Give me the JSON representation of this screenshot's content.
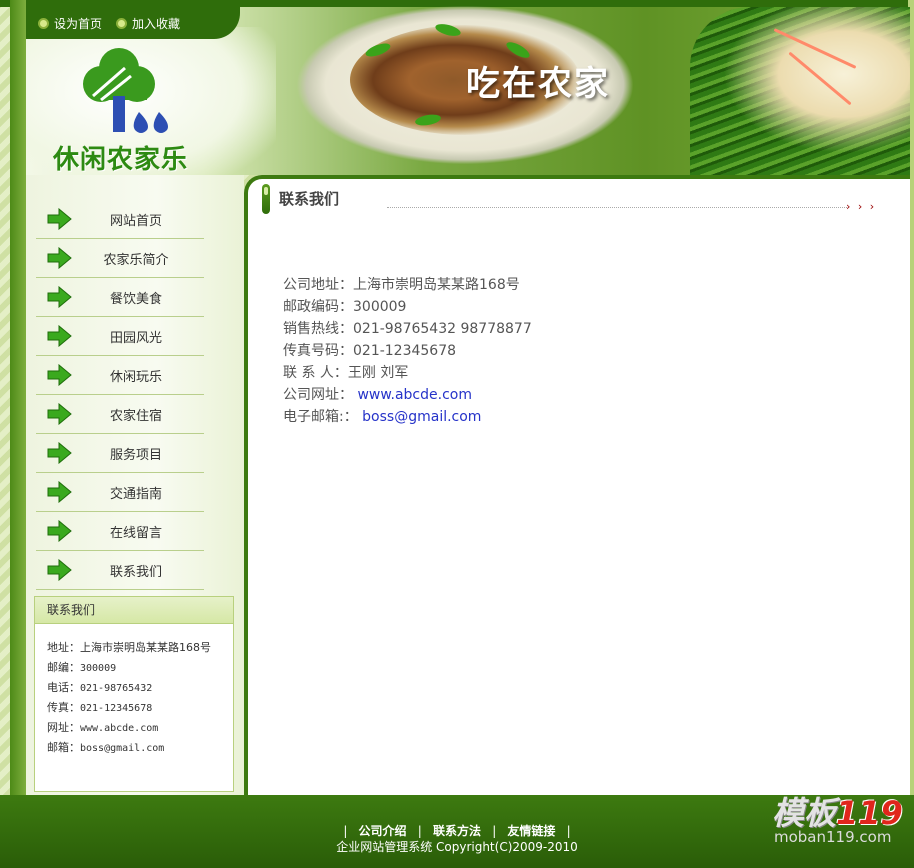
{
  "header": {
    "quick_links": [
      "设为首页",
      "加入收藏"
    ],
    "logo_text": "休闲农家乐",
    "slogan": "吃在农家"
  },
  "sidebar": {
    "nav_items": [
      "网站首页",
      "农家乐简介",
      "餐饮美食",
      "田园风光",
      "休闲玩乐",
      "农家住宿",
      "服务项目",
      "交通指南",
      "在线留言",
      "联系我们"
    ],
    "contact": {
      "title": "联系我们",
      "lines": [
        "地址：上海市崇明岛某某路168号",
        "邮编：",
        "电话：",
        "传真：",
        "网址：",
        "邮箱："
      ],
      "values": [
        "",
        "300009",
        "021-98765432",
        "021-12345678",
        "www.abcde.com",
        "boss@gmail.com"
      ]
    }
  },
  "main": {
    "title": "联系我们",
    "more": "› › ›",
    "info": [
      {
        "label": "公司地址：",
        "value": "上海市崇明岛某某路168号"
      },
      {
        "label": "邮政编码：",
        "value": "300009"
      },
      {
        "label": "销售热线：",
        "value": "021-98765432 98778877"
      },
      {
        "label": "传真号码：",
        "value": "021-12345678"
      },
      {
        "label": "联 系 人：",
        "value": "王刚 刘军"
      },
      {
        "label": "公司网址：",
        "value": "www.abcde.com"
      },
      {
        "label": "电子邮箱:：",
        "value": "boss@gmail.com"
      }
    ]
  },
  "footer": {
    "links": [
      "公司介绍",
      "联系方法",
      "友情链接"
    ],
    "copyright": "企业网站管理系统 Copyright(C)2009-2010"
  },
  "watermark": {
    "brand": "模板",
    "number": "119",
    "url": "moban119.com"
  },
  "colors": {
    "primary_green": "#2f6d0b",
    "link_blue": "#2633c9"
  }
}
